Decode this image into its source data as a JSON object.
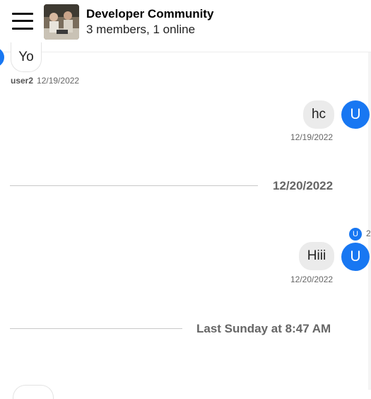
{
  "header": {
    "title": "Developer Community",
    "subtitle": "3 members, 1 online",
    "menu_icon": "hamburger-icon",
    "avatar_icon": "group-photo-icon"
  },
  "messages": [
    {
      "text": "Yo",
      "author": "user2",
      "date": "12/19/2022",
      "direction": "incoming"
    },
    {
      "text": "hc",
      "avatar": "U",
      "date": "12/19/2022",
      "direction": "outgoing"
    },
    {
      "text": "Hiii",
      "avatar": "U",
      "date": "12/20/2022",
      "direction": "outgoing",
      "read_receipt": {
        "avatar": "U",
        "count": "2"
      }
    }
  ],
  "dividers": [
    {
      "label": "12/20/2022"
    },
    {
      "label": "Last Sunday at 8:47 AM"
    }
  ],
  "colors": {
    "accent": "#1877f2",
    "outgoing_bubble": "#ebebeb"
  }
}
